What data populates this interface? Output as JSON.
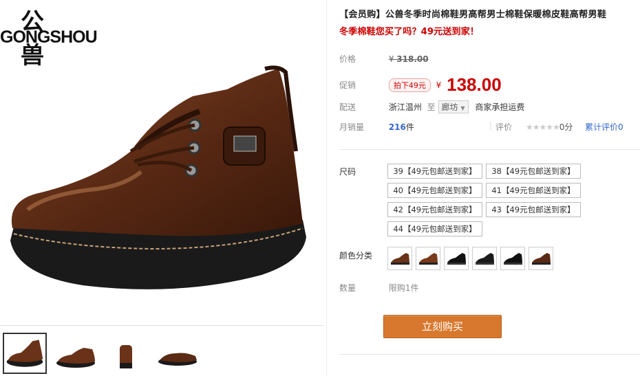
{
  "brand": {
    "cn": "公兽",
    "en": "GONGSHOU"
  },
  "title": "【会员购】公兽冬季时尚棉鞋男高帮男士棉鞋保暖棉皮鞋高帮男鞋",
  "subtitle": "冬季棉鞋您买了吗？49元送到家！",
  "price": {
    "label": "价格",
    "yen": "¥",
    "value": "318.00"
  },
  "promo": {
    "label": "促销",
    "badge": "拍下49元",
    "yen": "¥",
    "value": "138.00"
  },
  "shipping": {
    "label": "配送",
    "from": "浙江温州",
    "to_word": "至",
    "to_city": "廊坊",
    "note": "商家承担运费"
  },
  "sales": {
    "label": "月销量",
    "count": "216",
    "unit": "件",
    "rating_label": "评价",
    "stars": "★★★★★",
    "score": "0分",
    "reviews": "累计评价0"
  },
  "sizes": {
    "label": "尺码",
    "options": [
      "39【49元包邮送到家】",
      "38【49元包邮送到家】",
      "40【49元包邮送到家】",
      "41【49元包邮送到家】",
      "42【49元包邮送到家】",
      "43【49元包邮送到家】",
      "44【49元包邮送到家】"
    ]
  },
  "colors": {
    "label": "颜色分类",
    "swatches": [
      "brown",
      "brown",
      "black",
      "black",
      "black",
      "brown"
    ]
  },
  "quantity": {
    "label": "数量",
    "limit": "限购1件"
  },
  "buy_button": "立刻购买",
  "colors_hex": {
    "accent": "#cc0000",
    "buy": "#d8782e",
    "link": "#3366cc"
  }
}
